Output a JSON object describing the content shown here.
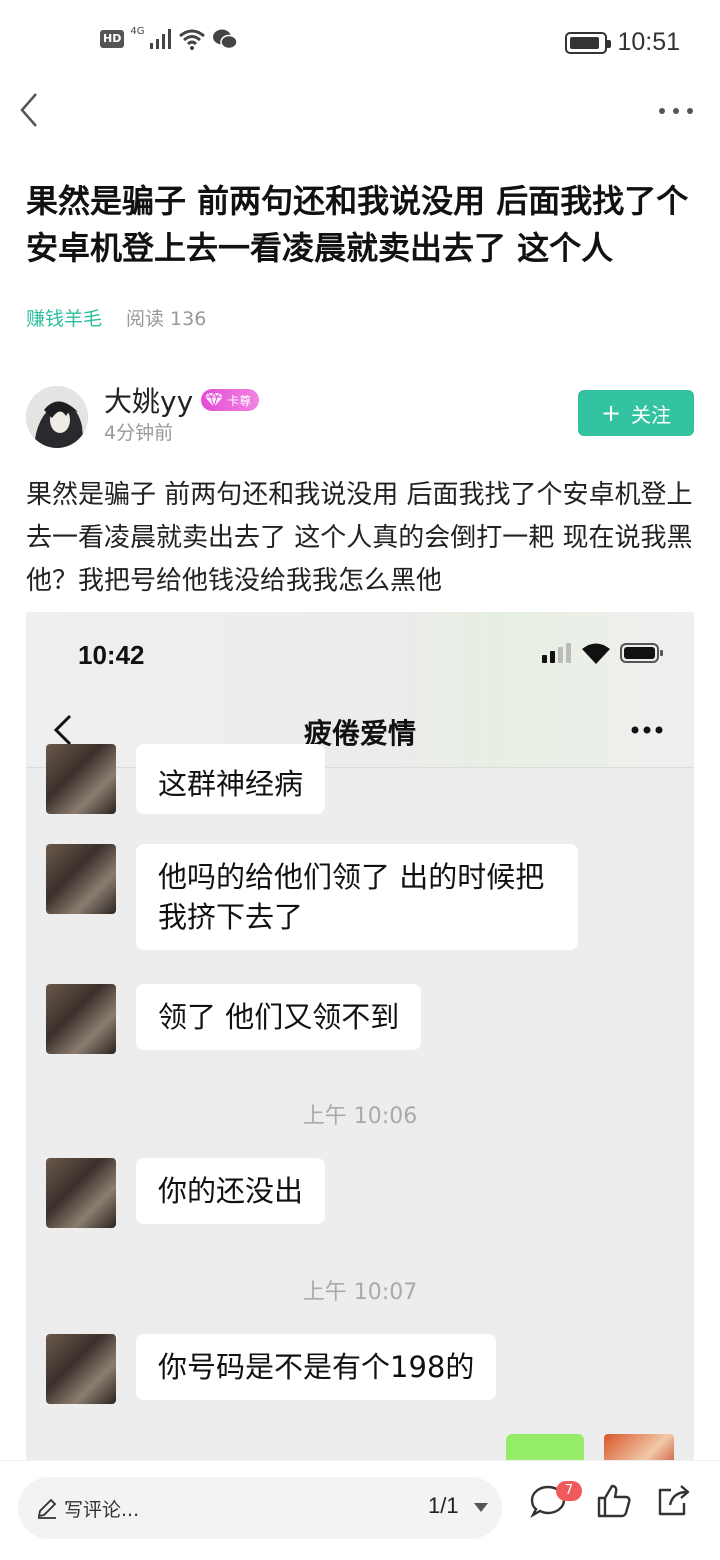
{
  "status_bar": {
    "hd": "HD",
    "network": "4G",
    "time": "10:51",
    "battery_level": 0.9
  },
  "article": {
    "title": "果然是骗子 前两句还和我说没用 后面我找了个安卓机登上去一看凌晨就卖出去了 这个人",
    "tag": "赚钱羊毛",
    "reads": "阅读 136",
    "author": {
      "name": "大姚yy",
      "badge": "卡尊",
      "time": "4分钟前"
    },
    "follow_label": "关注",
    "body": "果然是骗子 前两句还和我说没用 后面我找了个安卓机登上去一看凌晨就卖出去了 这个人真的会倒打一耙 现在说我黑他？我把号给他钱没给我我怎么黑他"
  },
  "chat_screenshot": {
    "time": "10:42",
    "title": "疲倦爱情",
    "messages": [
      {
        "text": "这群神经病"
      },
      {
        "text": "他吗的给他们领了  出的时候把我挤下去了"
      },
      {
        "text": "领了 他们又领不到"
      },
      {
        "timestamp": "上午 10:06"
      },
      {
        "text": "你的还没出"
      },
      {
        "timestamp": "上午 10:07"
      },
      {
        "text": "你号码是不是有个198的"
      }
    ]
  },
  "bottom_bar": {
    "comment_placeholder": "写评论...",
    "page": "1/1",
    "comment_count": "7"
  },
  "colors": {
    "accent": "#33c3a0",
    "tag": "#2cbd9f",
    "badge": "#f05a5a"
  },
  "icons": [
    "back-icon",
    "more-icon",
    "pen-icon",
    "comment-icon",
    "like-icon",
    "share-icon"
  ]
}
